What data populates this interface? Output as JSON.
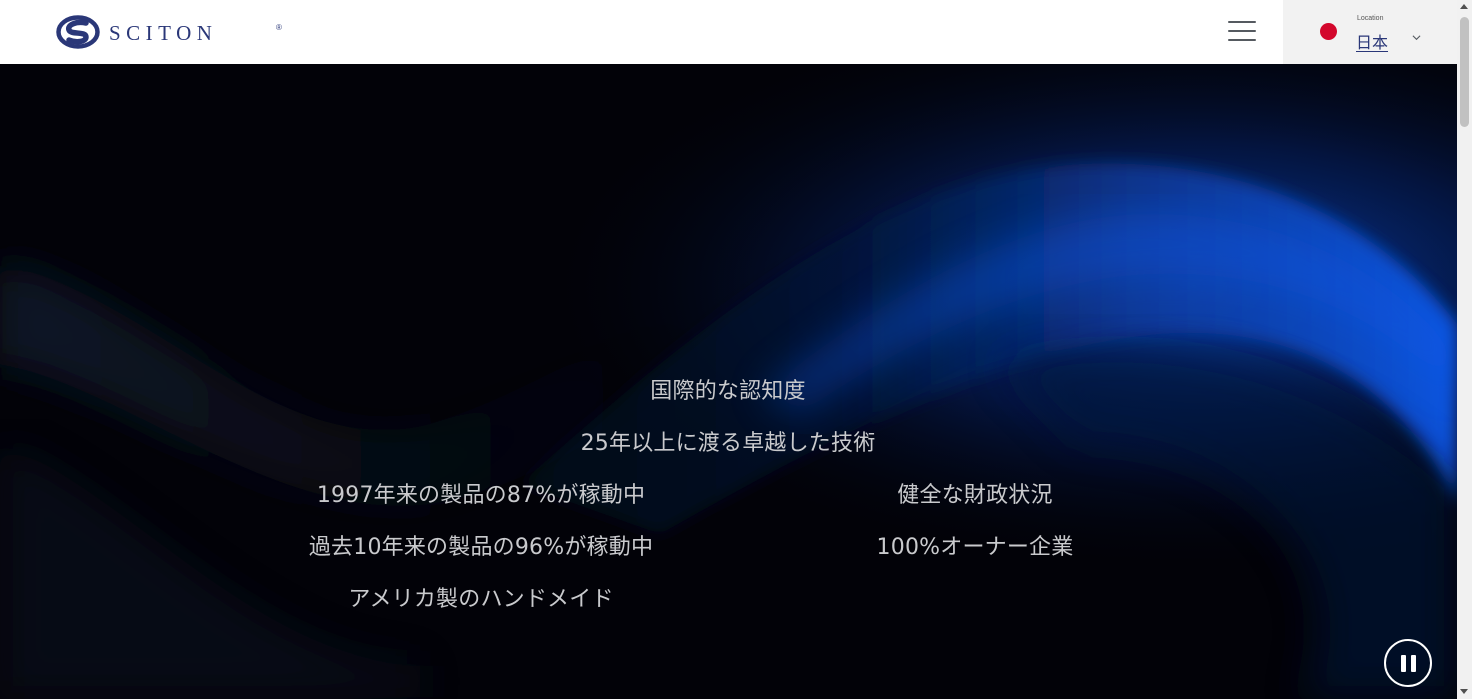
{
  "header": {
    "logo_text": "SCITON",
    "logo_registered": "®",
    "location_label": "Location",
    "location_value": "日本"
  },
  "hero": {
    "features": [
      "国際的な認知度",
      "25年以上に渡る卓越した技術",
      "1997年来の製品の87%が稼動中",
      "健全な財政状況",
      "過去10年来の製品の96%が稼動中",
      "100%オーナー企業",
      "アメリカ製のハンドメイド"
    ]
  },
  "colors": {
    "brand": "#2a3778",
    "flag_red": "#d3072c",
    "hero_text": "#c9cacd",
    "hero_background": "#020208",
    "wave_blue": "#0a55e0"
  },
  "icons": {
    "menu": "hamburger-icon",
    "location_toggle": "chevron-down-icon",
    "video_control": "pause-icon"
  }
}
